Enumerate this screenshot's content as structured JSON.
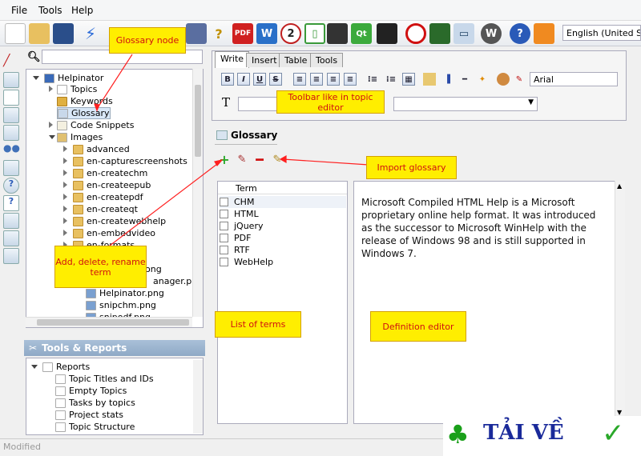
{
  "menu": [
    "File",
    "Tools",
    "Help"
  ],
  "language": "English (United Sta",
  "tree": {
    "root": "Helpinator",
    "items": [
      "Topics",
      "Keywords",
      "Glossary",
      "Code Snippets",
      "Images",
      "advanced",
      "en-capturescreenshots",
      "en-createchm",
      "en-createepub",
      "en-createpdf",
      "en-createqt",
      "en-createwebhelp",
      "en-embedvideo",
      "en-formats"
    ],
    "partial": [
      "ong",
      "anager.png"
    ],
    "files": [
      "Helpinator.png",
      "snipchm.png",
      "snipodf.png"
    ]
  },
  "tools": {
    "title": "Tools & Reports",
    "root": "Reports",
    "items": [
      "Topic Titles and IDs",
      "Empty Topics",
      "Tasks by topics",
      "Project stats",
      "Topic Structure"
    ]
  },
  "status": "Modified",
  "editor": {
    "tabs": [
      "Write",
      "Insert",
      "Table",
      "Tools"
    ],
    "font": "Arial",
    "format_buttons": [
      "B",
      "I",
      "U",
      "S"
    ]
  },
  "glossary": {
    "title": "Glossary",
    "term_header": "Term",
    "terms": [
      "CHM",
      "HTML",
      "jQuery",
      "PDF",
      "RTF",
      "WebHelp"
    ],
    "definition": "Microsoft Compiled HTML Help is a Microsoft proprietary online help format. It was introduced as the successor to Microsoft WinHelp with the release of Windows 98 and is still supported in Windows 7."
  },
  "callouts": {
    "glossary_node": "Glossary node",
    "toolbar": "Toolbar like in topic editor",
    "import": "Import glossary",
    "add_delete": "Add, delete, rename term",
    "list_terms": "List of terms",
    "def_editor": "Definition editor"
  },
  "logo": {
    "text": "TẢI VỀ"
  },
  "colors": {
    "callout": "#ffee00",
    "callout_text": "#d01010",
    "arrow": "#ff2020"
  }
}
